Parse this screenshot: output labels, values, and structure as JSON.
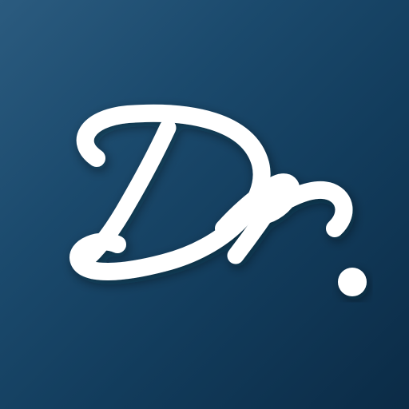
{
  "app_icon": {
    "logo_text": "Dr.",
    "colors": {
      "background_top_left": "#2b5b7f",
      "background_bottom_right": "#0b2b46",
      "glyph": "#ffffff"
    },
    "icon": "script-dr-monogram"
  }
}
